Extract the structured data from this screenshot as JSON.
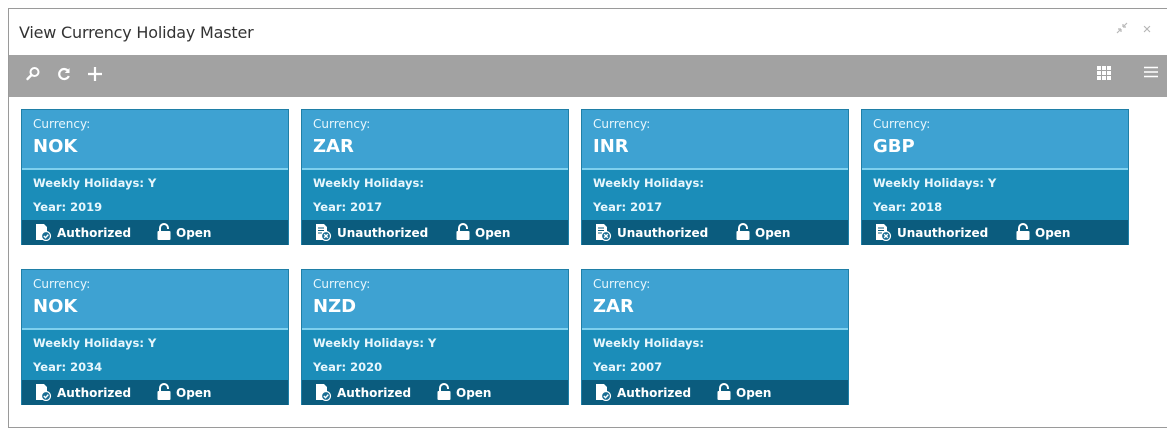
{
  "window": {
    "title": "View Currency Holiday Master"
  },
  "toolbar": {
    "search_icon": "search-icon",
    "refresh_icon": "refresh-icon",
    "add_icon": "plus-icon",
    "tile_view_icon": "grid-view-icon",
    "list_view_icon": "list-view-icon"
  },
  "labels": {
    "currency": "Currency:",
    "weekly": "Weekly Holidays:",
    "year": "Year:"
  },
  "cards": [
    {
      "currency": "NOK",
      "weekly": "Y",
      "year": "2019",
      "auth": "Authorized",
      "status": "Open"
    },
    {
      "currency": "ZAR",
      "weekly": "",
      "year": "2017",
      "auth": "Unauthorized",
      "status": "Open"
    },
    {
      "currency": "INR",
      "weekly": "",
      "year": "2017",
      "auth": "Unauthorized",
      "status": "Open"
    },
    {
      "currency": "GBP",
      "weekly": "Y",
      "year": "2018",
      "auth": "Unauthorized",
      "status": "Open"
    },
    {
      "currency": "NOK",
      "weekly": "Y",
      "year": "2034",
      "auth": "Authorized",
      "status": "Open"
    },
    {
      "currency": "NZD",
      "weekly": "Y",
      "year": "2020",
      "auth": "Authorized",
      "status": "Open"
    },
    {
      "currency": "ZAR",
      "weekly": "",
      "year": "2007",
      "auth": "Authorized",
      "status": "Open"
    }
  ],
  "colors": {
    "toolbar": "#a2a2a2",
    "card_top": "#3ea2d2",
    "card_mid": "#1b8db9",
    "card_footer": "#0b5c7e"
  }
}
